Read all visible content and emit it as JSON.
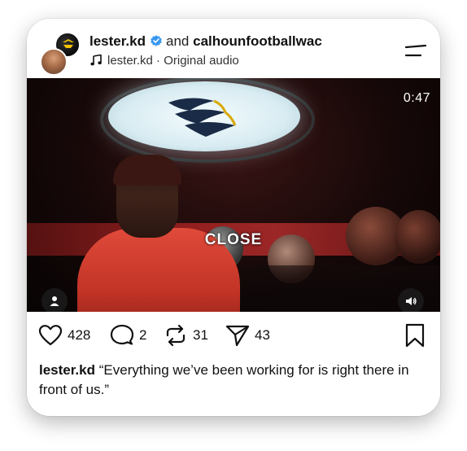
{
  "post": {
    "username": "lester.kd",
    "conjunction": "and",
    "collaborator": "calhounfootballwac",
    "audio": {
      "owner": "lester.kd",
      "separator": " · ",
      "label": "Original audio"
    }
  },
  "video": {
    "timestamp": "0:47",
    "overlay_label": "CLOSE"
  },
  "actions": {
    "likes": "428",
    "comments": "2",
    "reposts": "31",
    "shares": "43"
  },
  "caption": {
    "username": "lester.kd",
    "text": "“Everything we’ve been working for is right there in front of us.”"
  },
  "icons": {
    "verified": "verified-badge-icon",
    "audio": "music-note-icon",
    "menu": "menu-icon",
    "user_tag": "user-tag-icon",
    "volume": "volume-icon",
    "like": "heart-icon",
    "comment": "comment-icon",
    "repost": "repost-icon",
    "share": "send-icon",
    "save": "bookmark-icon"
  },
  "colors": {
    "verified_blue": "#3897f0",
    "text": "#111111"
  }
}
